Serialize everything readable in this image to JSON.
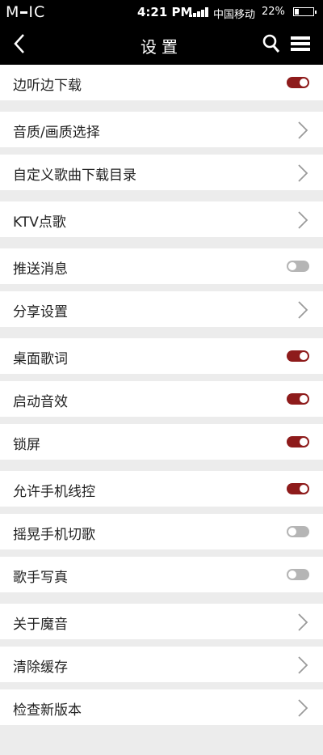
{
  "statusbar": {
    "logo_left": "M",
    "logo_right": "IC",
    "time": "4:21 PM",
    "carrier": "中国移动",
    "battery": "22%"
  },
  "header": {
    "title": "设置"
  },
  "colors": {
    "accent": "#8e1b1b",
    "toggle_off": "#b5b5b5",
    "background": "#ececec"
  },
  "settings": [
    {
      "label": "边听边下载",
      "type": "toggle",
      "on": true
    },
    {
      "label": "音质/画质选择",
      "type": "link"
    },
    {
      "label": "自定义歌曲下载目录",
      "type": "link"
    },
    {
      "label": "KTV点歌",
      "type": "link"
    },
    {
      "label": "推送消息",
      "type": "toggle",
      "on": false
    },
    {
      "label": "分享设置",
      "type": "link"
    },
    {
      "label": "桌面歌词",
      "type": "toggle",
      "on": true
    },
    {
      "label": "启动音效",
      "type": "toggle",
      "on": true
    },
    {
      "label": "锁屏",
      "type": "toggle",
      "on": true
    },
    {
      "label": "允许手机线控",
      "type": "toggle",
      "on": true
    },
    {
      "label": "摇晃手机切歌",
      "type": "toggle",
      "on": false
    },
    {
      "label": "歌手写真",
      "type": "toggle",
      "on": false
    },
    {
      "label": "关于魔音",
      "type": "link"
    },
    {
      "label": "清除缓存",
      "type": "link"
    },
    {
      "label": "检查新版本",
      "type": "link"
    }
  ]
}
